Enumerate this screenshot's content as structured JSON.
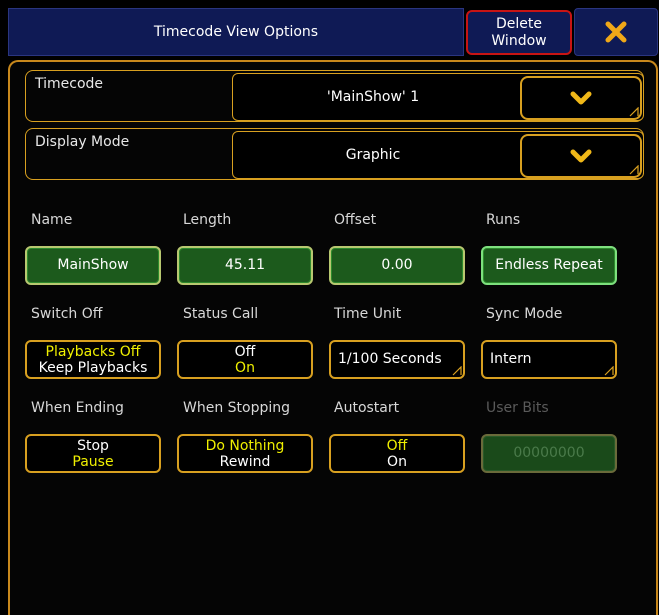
{
  "window": {
    "title": "Timecode View Options",
    "delete_label_line1": "Delete",
    "delete_label_line2": "Window"
  },
  "selectors": {
    "timecode": {
      "label": "Timecode",
      "value": "'MainShow' 1"
    },
    "display_mode": {
      "label": "Display Mode",
      "value": "Graphic"
    }
  },
  "fields": {
    "name": {
      "label": "Name",
      "value": "MainShow"
    },
    "length": {
      "label": "Length",
      "value": "45.11"
    },
    "offset": {
      "label": "Offset",
      "value": "0.00"
    },
    "runs": {
      "label": "Runs",
      "value": "Endless Repeat"
    },
    "switch_off": {
      "label": "Switch Off",
      "opt1": "Playbacks Off",
      "opt2": "Keep Playbacks"
    },
    "status_call": {
      "label": "Status Call",
      "opt1": "Off",
      "opt2": "On"
    },
    "time_unit": {
      "label": "Time Unit",
      "value": "1/100 Seconds"
    },
    "sync_mode": {
      "label": "Sync Mode",
      "value": "Intern"
    },
    "when_ending": {
      "label": "When Ending",
      "opt1": "Stop",
      "opt2": "Pause"
    },
    "when_stopping": {
      "label": "When Stopping",
      "opt1": "Do Nothing",
      "opt2": "Rewind"
    },
    "autostart": {
      "label": "Autostart",
      "opt1": "Off",
      "opt2": "On"
    },
    "user_bits": {
      "label": "User Bits",
      "value": "00000000"
    }
  },
  "colors": {
    "accent_orange": "#d8a020",
    "title_blue": "#0f1a55",
    "field_green": "#1c5a1c",
    "active_yellow": "#f0f000",
    "delete_red": "#c81414"
  },
  "icons": {
    "close": "close-x-icon",
    "dropdown": "chevron-down-icon"
  }
}
